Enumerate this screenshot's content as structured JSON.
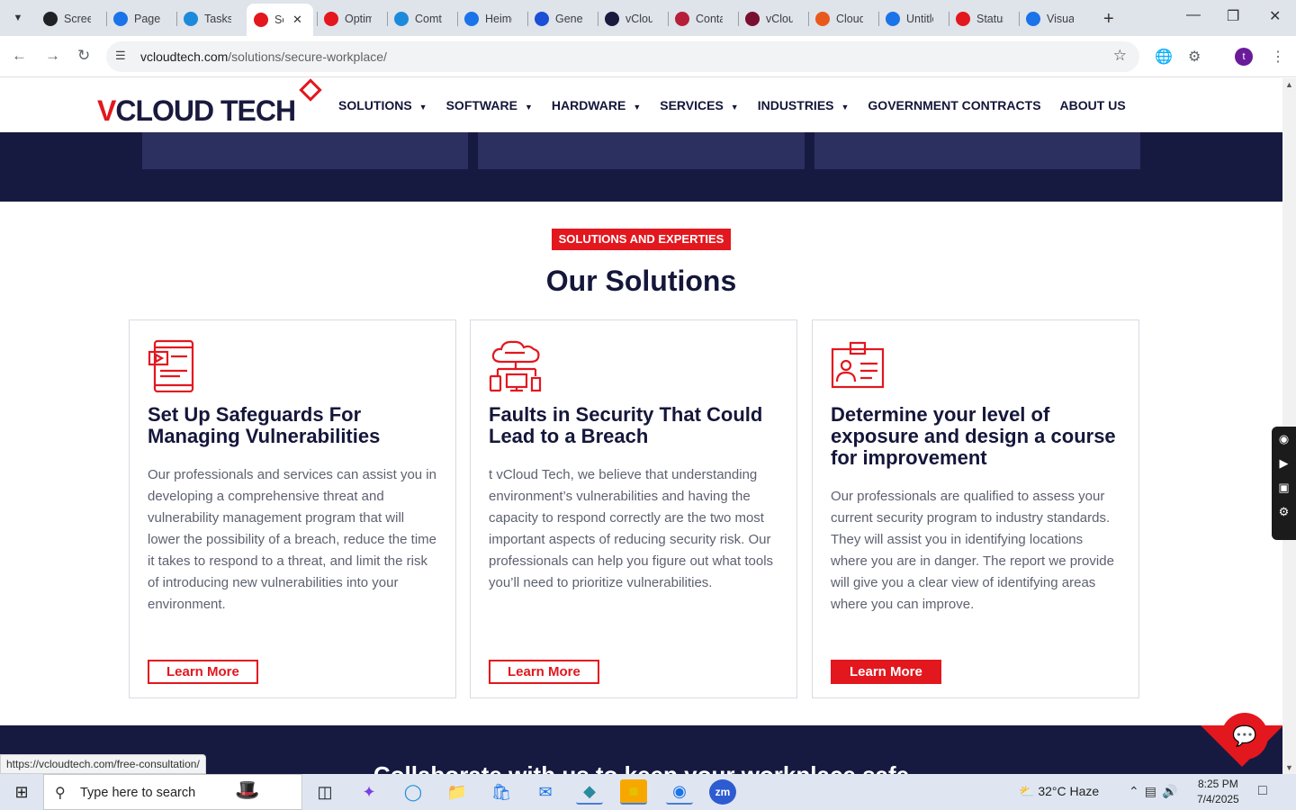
{
  "browser": {
    "tabs": [
      {
        "label": "Screen",
        "color": "#202124",
        "icon": "camera-icon"
      },
      {
        "label": "PageSpeed",
        "color": "#1a73e8",
        "icon": "gauge-icon"
      },
      {
        "label": "Tasks",
        "color": "#1c8adb",
        "icon": "tasks-icon"
      },
      {
        "label": "Secure Workplace",
        "color": "#e3171e",
        "icon": "vcloud-icon",
        "active": true
      },
      {
        "label": "Optimize",
        "color": "#e3171e",
        "icon": "vcloud-icon"
      },
      {
        "label": "Comtech",
        "color": "#1c8adb",
        "icon": "globe-icon"
      },
      {
        "label": "Heimdal",
        "color": "#1a73e8",
        "icon": "scale-icon"
      },
      {
        "label": "Generate",
        "color": "#1a4fd6",
        "icon": "x-icon"
      },
      {
        "label": "vCloud",
        "color": "#1a1a3e",
        "icon": "check-icon"
      },
      {
        "label": "Contact",
        "color": "#b51f3a",
        "icon": "ball-icon"
      },
      {
        "label": "vCloud",
        "color": "#7a1030",
        "icon": "v-icon"
      },
      {
        "label": "Cloud",
        "color": "#e85a1c",
        "icon": "swoosh-icon"
      },
      {
        "label": "Untitled",
        "color": "#1a73e8",
        "icon": "doc-icon"
      },
      {
        "label": "Status",
        "color": "#e3171e",
        "icon": "status-icon"
      },
      {
        "label": "Visual",
        "color": "#1a73e8",
        "icon": "pulse-icon"
      }
    ],
    "url_host": "vcloudtech.com",
    "url_path": "/solutions/secure-workplace/",
    "profile_initial": "t",
    "status_url": "https://vcloudtech.com/free-consultation/"
  },
  "site": {
    "logo_v": "V",
    "logo_rest": "CLOUD TECH",
    "menu": [
      {
        "label": "SOLUTIONS",
        "has_caret": true
      },
      {
        "label": "SOFTWARE",
        "has_caret": true
      },
      {
        "label": "HARDWARE",
        "has_caret": true
      },
      {
        "label": "SERVICES",
        "has_caret": true
      },
      {
        "label": "INDUSTRIES",
        "has_caret": true
      },
      {
        "label": "GOVERNMENT CONTRACTS",
        "has_caret": false
      },
      {
        "label": "ABOUT US",
        "has_caret": false
      }
    ],
    "tag": "SOLUTIONS AND EXPERTIES",
    "section_title": "Our Solutions",
    "cards": [
      {
        "icon": "tablet-video-icon",
        "title": "Set Up Safeguards For Managing Vulnerabilities",
        "body": "Our professionals and services can assist you in developing a comprehensive threat and vulnerability management program that will lower the possibility of a breach, reduce the time it takes to respond to a threat, and limit the risk of introducing new vulnerabilities into your environment.",
        "button": "Learn More",
        "button_filled": false
      },
      {
        "icon": "cloud-network-icon",
        "title": "Faults in Security That Could Lead to a Breach",
        "body": "t vCloud Tech, we believe that understanding environment’s vulnerabilities and having the capacity to respond correctly are the two most important aspects of reducing security risk. Our professionals can help you figure out what tools you’ll need to prioritize vulnerabilities.",
        "button": "Learn More",
        "button_filled": false
      },
      {
        "icon": "id-card-icon",
        "title": "Determine your level of exposure and design a course for improvement",
        "body": "Our professionals are qualified to assess your current security program to industry standards. They will assist you in identifying locations where you are in danger. The report we provide will give you a clear view of identifying areas where you can improve.",
        "button": "Learn More",
        "button_filled": true
      }
    ],
    "cta_text": "Collaborate with us to keep your workplace safe"
  },
  "colors": {
    "brand_red": "#e3171e",
    "brand_navy": "#161a41"
  },
  "taskbar": {
    "search_placeholder": "Type here to search",
    "weather": "32°C  Haze",
    "time": "8:25 PM",
    "date": "7/4/2025"
  }
}
